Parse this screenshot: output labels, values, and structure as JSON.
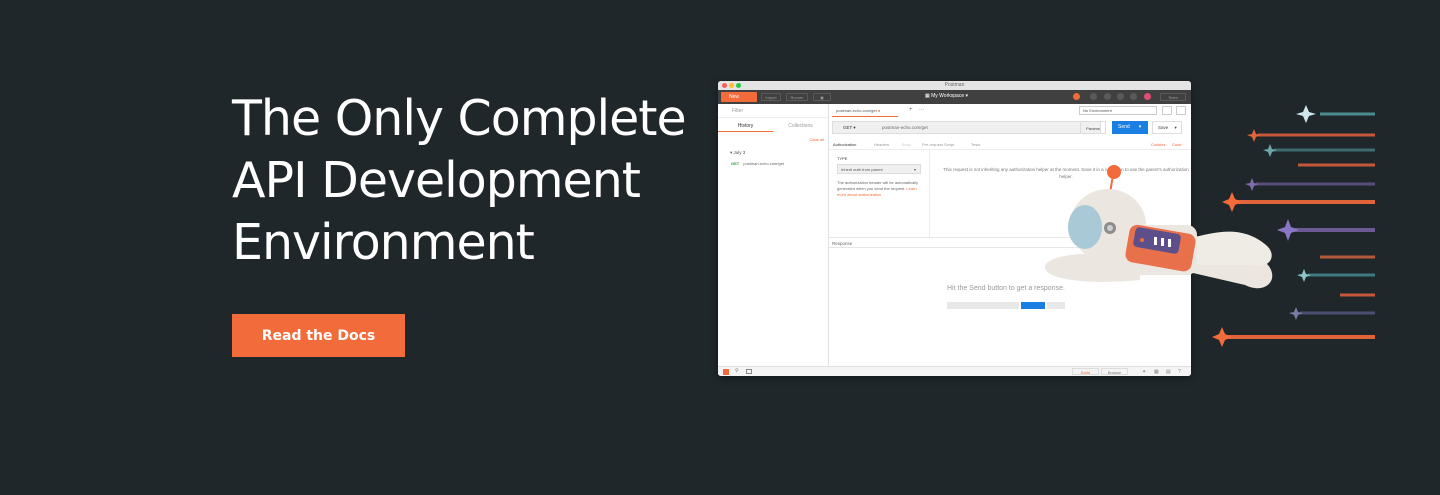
{
  "hero": {
    "title_lines": [
      "The Only Complete",
      "API Development",
      "Environment"
    ],
    "cta_label": "Read the Docs"
  },
  "app": {
    "window_title": "Postman",
    "toolbar": {
      "new_label": "New",
      "import_label": "Import",
      "runner_label": "Runner",
      "workspace": "My Workspace",
      "signin_label": "Team"
    },
    "sidebar": {
      "filter_placeholder": "Filter",
      "tabs": [
        "History",
        "Collections"
      ],
      "clear_all": "Clear all",
      "date_group": "July 3",
      "history_item": {
        "method": "GET",
        "url": "postman-echo.com/get"
      }
    },
    "request": {
      "tab_label": "postman-echo.com/get",
      "environment": "No Environment",
      "method": "GET",
      "url": "postman-echo.com/get",
      "params_label": "Params",
      "send_label": "Send",
      "save_label": "Save",
      "subtabs": [
        "Authorization",
        "Headers",
        "Body",
        "Pre-request Script",
        "Tests"
      ],
      "right_links": [
        "Cookies",
        "Code"
      ]
    },
    "auth": {
      "type_label": "TYPE",
      "type_value": "Inherit auth from parent",
      "note": "The authorization header will be automatically generated when you send the request.",
      "note_link": "Learn more about authorization",
      "message": "This request is not inheriting any authorization helper at the moment. Save it in a collection to use the parent's authorization helper."
    },
    "response": {
      "label": "Response",
      "hint": "Hit the Send button to get a response."
    },
    "statusbar": {
      "build_label": "Build",
      "browse_label": "Browse"
    }
  },
  "colors": {
    "background": "#1f272b",
    "accent": "#f26b3a",
    "send_blue": "#1b7ee3"
  }
}
